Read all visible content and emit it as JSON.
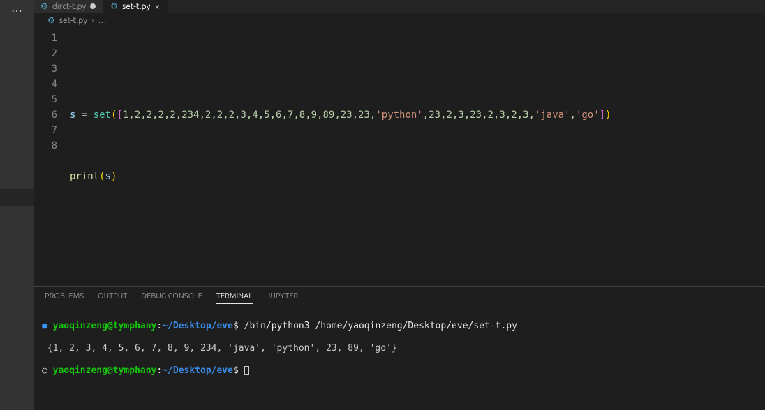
{
  "tabs": [
    {
      "icon": "python",
      "label": "dirct-t.py",
      "dirty": true,
      "active": false
    },
    {
      "icon": "python",
      "label": "set-t.py",
      "dirty": false,
      "active": true
    }
  ],
  "breadcrumb": {
    "icon": "python",
    "file": "set-t.py",
    "sep": "›",
    "more": "…"
  },
  "editor": {
    "line_numbers": [
      "1",
      "2",
      "3",
      "4",
      "5",
      "6",
      "7",
      "8"
    ],
    "lines": {
      "l1": "",
      "l2": "",
      "l3": {
        "var": "s",
        "assign": " = ",
        "set": "set",
        "lp": "(",
        "lb": "[",
        "items_part1": "1,2,2,2,2,234,2,2,2,3,4,5,6,7,8,9,89,23,23,",
        "str1": "'python'",
        "items_part2": ",23,2,3,23,2,3,2,3,",
        "str2": "'java'",
        "comma1": ",",
        "str3": "'go'",
        "rb": "]",
        "rp": ")"
      },
      "l4": "",
      "l5": {
        "print": "print",
        "lp": "(",
        "arg": "s",
        "rp": ")"
      },
      "l6": "",
      "l7": "",
      "l8": ""
    }
  },
  "panel": {
    "tabs": [
      "PROBLEMS",
      "OUTPUT",
      "DEBUG CONSOLE",
      "TERMINAL",
      "JUPYTER"
    ],
    "active_tab": "TERMINAL"
  },
  "terminal": {
    "line1": {
      "bullet": "●",
      "user": "yaoqinzeng",
      "at": "@",
      "host": "tymphany",
      "colon": ":",
      "path": "~/Desktop/eve",
      "dollar": "$ ",
      "cmd": "/bin/python3 /home/yaoqinzeng/Desktop/eve/set-t.py"
    },
    "line2": " {1, 2, 3, 4, 5, 6, 7, 8, 9, 234, 'java', 'python', 23, 89, 'go'}",
    "line3": {
      "bullet": "○",
      "user": "yaoqinzeng",
      "at": "@",
      "host": "tymphany",
      "colon": ":",
      "path": "~/Desktop/eve",
      "dollar": "$ "
    }
  }
}
